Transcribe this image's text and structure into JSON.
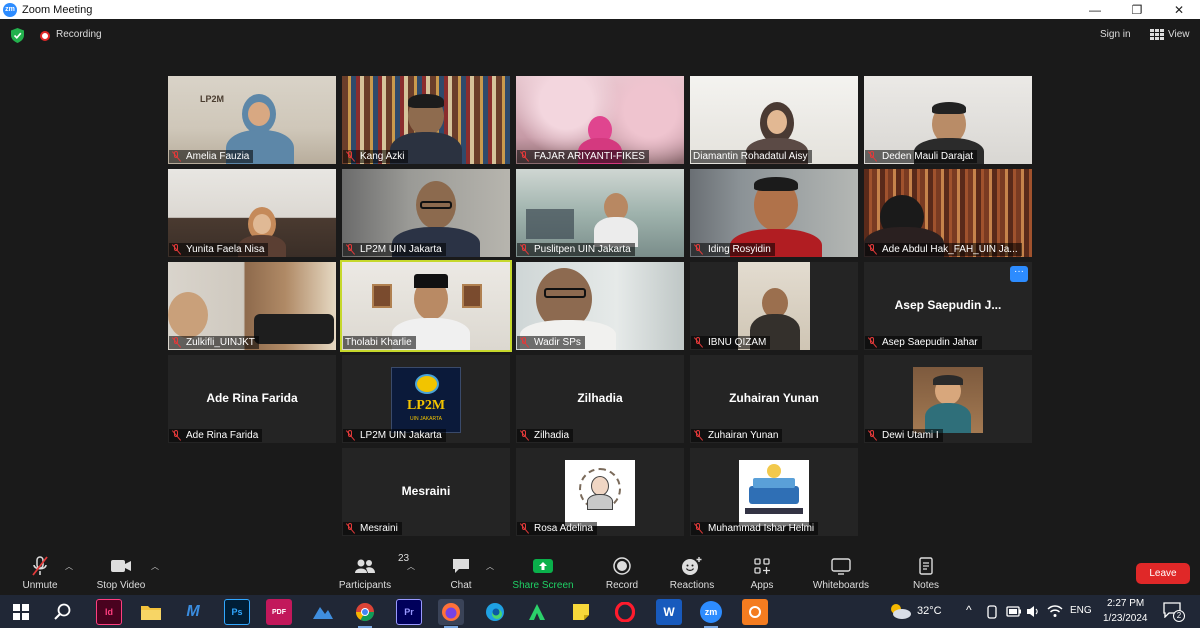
{
  "window": {
    "app_logo": "zm",
    "title": "Zoom Meeting",
    "controls": [
      "—",
      "❐",
      "✕"
    ]
  },
  "topbar": {
    "recording_label": "Recording",
    "signin_label": "Sign in",
    "view_label": "View"
  },
  "participants": [
    {
      "name": "Amelia Fauzia",
      "muted": true
    },
    {
      "name": "Kang Azki",
      "muted": true
    },
    {
      "name": "FAJAR ARIYANTI-FIKES",
      "muted": true
    },
    {
      "name": "Diamantin Rohadatul Aisy",
      "muted": false
    },
    {
      "name": "Deden Mauli Darajat",
      "muted": true
    },
    {
      "name": "Yunita Faela Nisa",
      "muted": true
    },
    {
      "name": "LP2M UIN Jakarta",
      "muted": true
    },
    {
      "name": "Puslitpen UIN Jakarta",
      "muted": true
    },
    {
      "name": "Iding Rosyidin",
      "muted": true
    },
    {
      "name": "Ade Abdul Hak_FAH_UIN Ja...",
      "muted": true
    },
    {
      "name": "Zulkifli_UINJKT",
      "muted": true
    },
    {
      "name": "Tholabi Kharlie",
      "muted": false,
      "speaking": true
    },
    {
      "name": "Wadir SPs",
      "muted": true
    },
    {
      "name": "IBNU QIZAM",
      "muted": true
    },
    {
      "name": "Asep Saepudin Jahar",
      "display_title": "Asep Saepudin J...",
      "muted": true,
      "more_button": "···"
    },
    {
      "name": "Ade Rina Farida",
      "display_title": "Ade Rina Farida",
      "muted": true
    },
    {
      "name": "LP2M UIN Jakarta",
      "muted": true,
      "logo_text": "LP2M",
      "logo_subtext": "UIN JAKARTA"
    },
    {
      "name": "Zilhadia",
      "display_title": "Zilhadia",
      "muted": true
    },
    {
      "name": "Zuhairan Yunan",
      "display_title": "Zuhairan Yunan",
      "muted": true
    },
    {
      "name": "Dewi Utami I",
      "muted": true
    },
    {
      "name": "Mesraini",
      "display_title": "Mesraini",
      "muted": true
    },
    {
      "name": "Rosa Adelina",
      "muted": true
    },
    {
      "name": "Muhammad Ishar Helmi",
      "muted": true
    }
  ],
  "toolbar": {
    "unmute_label": "Unmute",
    "stop_video_label": "Stop Video",
    "participants_label": "Participants",
    "participants_count": "23",
    "chat_label": "Chat",
    "share_label": "Share Screen",
    "record_label": "Record",
    "reactions_label": "Reactions",
    "apps_label": "Apps",
    "whiteboards_label": "Whiteboards",
    "notes_label": "Notes",
    "leave_label": "Leave"
  },
  "taskbar": {
    "apps": [
      "windows-start",
      "search",
      "indesign",
      "file-explorer",
      "zoom-meeting-app",
      "photoshop",
      "pdf-app",
      "maps-app",
      "chrome",
      "premiere",
      "firefox",
      "edge",
      "app-green",
      "sticky-notes",
      "opera",
      "word",
      "zoom",
      "app-orange"
    ],
    "id_label": "Id",
    "ps_label": "Ps",
    "pr_label": "Pr",
    "w_label": "W",
    "zm_label": "zm",
    "pdf_label": "PDF",
    "weather_temp": "32°C",
    "language": "ENG",
    "time": "2:27 PM",
    "date": "1/23/2024",
    "notifications": "2"
  },
  "colors": {
    "accent_blue": "#2d8cff",
    "leave_red": "#e02828",
    "share_green": "#0ab04b",
    "speaker_outline": "#c6d82b",
    "muted_red": "#e23a3a"
  }
}
